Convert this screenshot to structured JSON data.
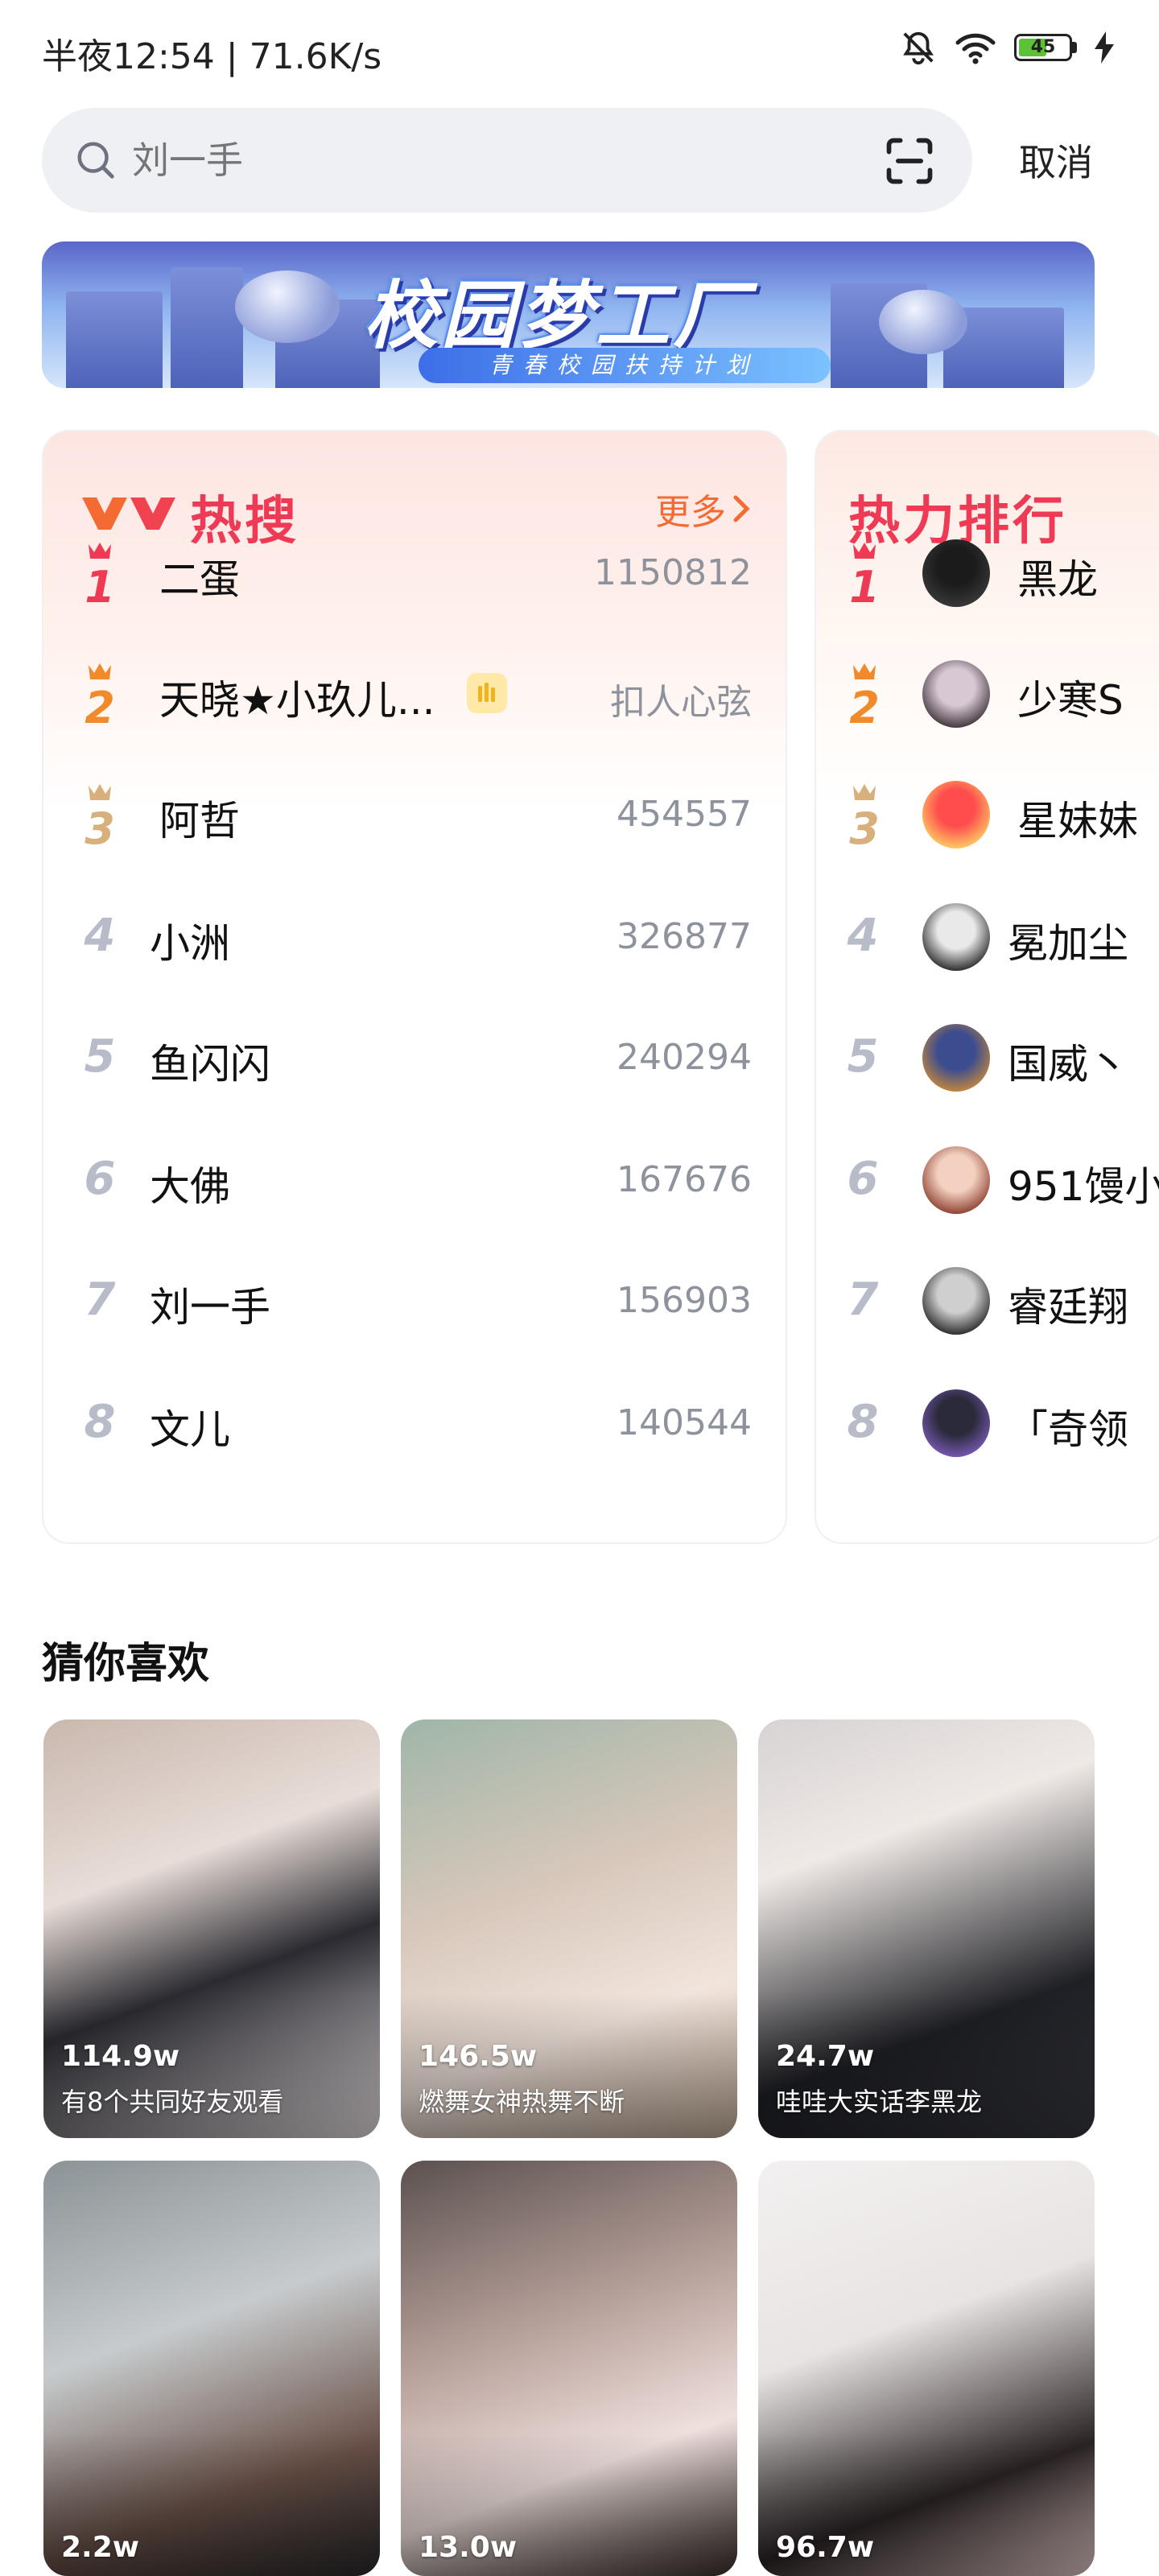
{
  "status_bar": {
    "text": "半夜12:54 | 71.6K/s",
    "battery": "45"
  },
  "search": {
    "placeholder": "刘一手",
    "cancel_label": "取消"
  },
  "banner": {
    "title": "校园梦工厂",
    "subtitle": "青春校园扶持计划"
  },
  "hot_search": {
    "title": "热搜",
    "logo_text": "YY",
    "more_label": "更多",
    "items": [
      {
        "rank": "1",
        "name": "二蛋",
        "value": "1150812"
      },
      {
        "rank": "2",
        "name": "天晓★小玖儿...",
        "value": "扣人心弦",
        "live": true
      },
      {
        "rank": "3",
        "name": "阿哲",
        "value": "454557"
      },
      {
        "rank": "4",
        "name": "小洲",
        "value": "326877"
      },
      {
        "rank": "5",
        "name": "鱼闪闪",
        "value": "240294"
      },
      {
        "rank": "6",
        "name": "大佛",
        "value": "167676"
      },
      {
        "rank": "7",
        "name": "刘一手",
        "value": "156903"
      },
      {
        "rank": "8",
        "name": "文儿",
        "value": "140544"
      }
    ]
  },
  "heat_rank": {
    "title": "热力排行",
    "items": [
      {
        "rank": "1",
        "name": "黑龙"
      },
      {
        "rank": "2",
        "name": "少寒S"
      },
      {
        "rank": "3",
        "name": "星妹妹"
      },
      {
        "rank": "4",
        "name": "冕加尘"
      },
      {
        "rank": "5",
        "name": "国威丶"
      },
      {
        "rank": "6",
        "name": "951馒小"
      },
      {
        "rank": "7",
        "name": "睿廷翔"
      },
      {
        "rank": "8",
        "name": "「奇领"
      }
    ]
  },
  "recommend": {
    "title": "猜你喜欢",
    "tiles": [
      {
        "viewers": "114.9w",
        "desc": "有8个共同好友观看"
      },
      {
        "viewers": "146.5w",
        "desc": "燃舞女神热舞不断"
      },
      {
        "viewers": "24.7w",
        "desc": "哇哇大实话李黑龙"
      },
      {
        "viewers": "2.2w",
        "desc": ""
      },
      {
        "viewers": "13.0w",
        "desc": ""
      },
      {
        "viewers": "96.7w",
        "desc": ""
      }
    ]
  },
  "colors": {
    "accent_red": "#ee3a55",
    "accent_orange": "#f36a32",
    "rank_gray": "#b8bcc9"
  }
}
